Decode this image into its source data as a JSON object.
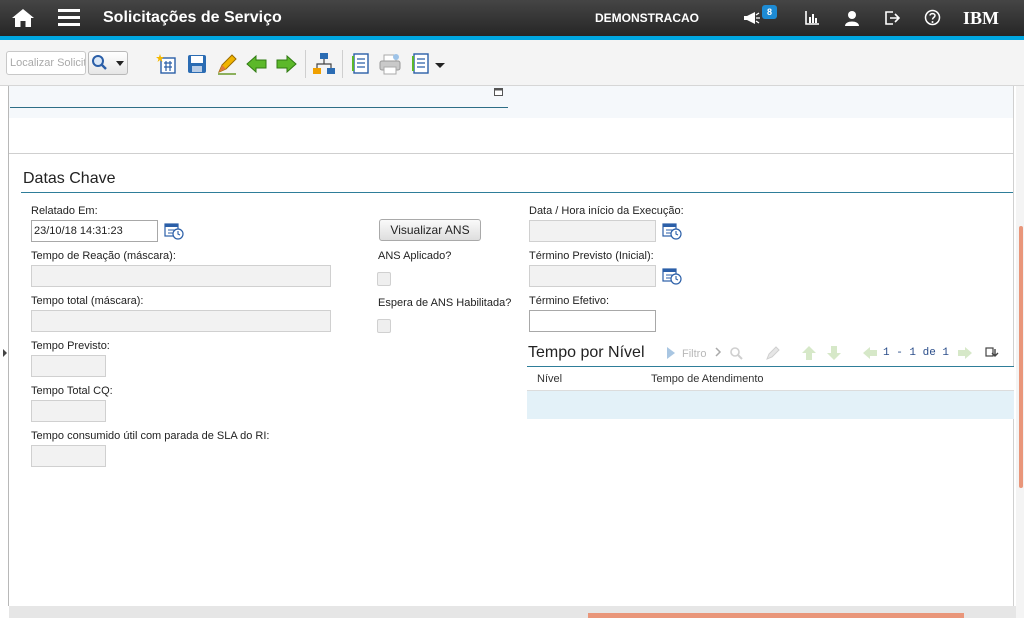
{
  "header": {
    "title": "Solicitações de Serviço",
    "user": "DEMONSTRACAO",
    "notification_count": "8",
    "brand": "IBM"
  },
  "toolbar": {
    "search_placeholder": "Localizar Solicit",
    "icons": [
      "new-record-icon",
      "save-icon",
      "edit-icon",
      "previous-icon",
      "next-icon",
      "workflow-icon",
      "report-icon",
      "print-icon",
      "reports-menu-icon"
    ]
  },
  "section": {
    "title": "Datas Chave"
  },
  "left_fields": {
    "reported_label": "Relatado Em:",
    "reported_value": "23/10/18 14:31:23",
    "reaction_label": "Tempo de Reação (máscara):",
    "total_label": "Tempo total (máscara):",
    "expected_label": "Tempo Previsto:",
    "total_cq_label": "Tempo Total CQ:",
    "consumed_label": "Tempo consumido útil com parada de SLA do RI:"
  },
  "middle_fields": {
    "view_sla_button": "Visualizar ANS",
    "sla_applied_label": "ANS Aplicado?",
    "sla_wait_label": "Espera de ANS Habilitada?"
  },
  "right_fields": {
    "exec_start_label": "Data / Hora início da Execução:",
    "expected_end_label": "Término Previsto (Inicial):",
    "actual_end_label": "Término Efetivo:"
  },
  "level_table": {
    "title": "Tempo por Nível",
    "filter_label": "Filtro",
    "pager": "1 - 1 de 1",
    "columns": [
      "Nível",
      "Tempo de Atendimento"
    ]
  },
  "colors": {
    "accent": "#00a7e1",
    "section_line": "#2e7d99",
    "row_highlight": "#e3f1f8"
  }
}
